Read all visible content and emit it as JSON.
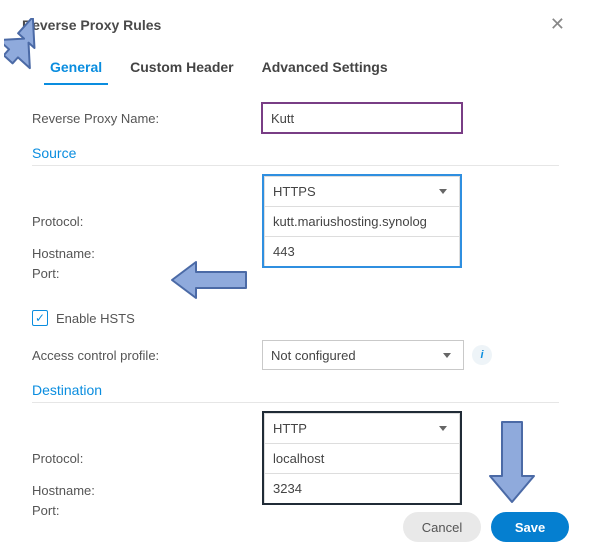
{
  "dialog": {
    "title": "Reverse Proxy Rules"
  },
  "tabs": {
    "general": "General",
    "custom_header": "Custom Header",
    "advanced": "Advanced Settings"
  },
  "fields": {
    "name_label": "Reverse Proxy Name:",
    "name_value": "Kutt",
    "source_head": "Source",
    "protocol_label": "Protocol:",
    "src_protocol": "HTTPS",
    "hostname_label": "Hostname:",
    "src_hostname": "kutt.mariushosting.synolog",
    "port_label": "Port:",
    "src_port": "443",
    "hsts_label": "Enable HSTS",
    "acp_label": "Access control profile:",
    "acp_value": "Not configured",
    "dest_head": "Destination",
    "dst_protocol": "HTTP",
    "dst_hostname": "localhost",
    "dst_port": "3234"
  },
  "buttons": {
    "cancel": "Cancel",
    "save": "Save"
  },
  "icons": {
    "close": "✕",
    "check": "✓",
    "info": "i"
  }
}
